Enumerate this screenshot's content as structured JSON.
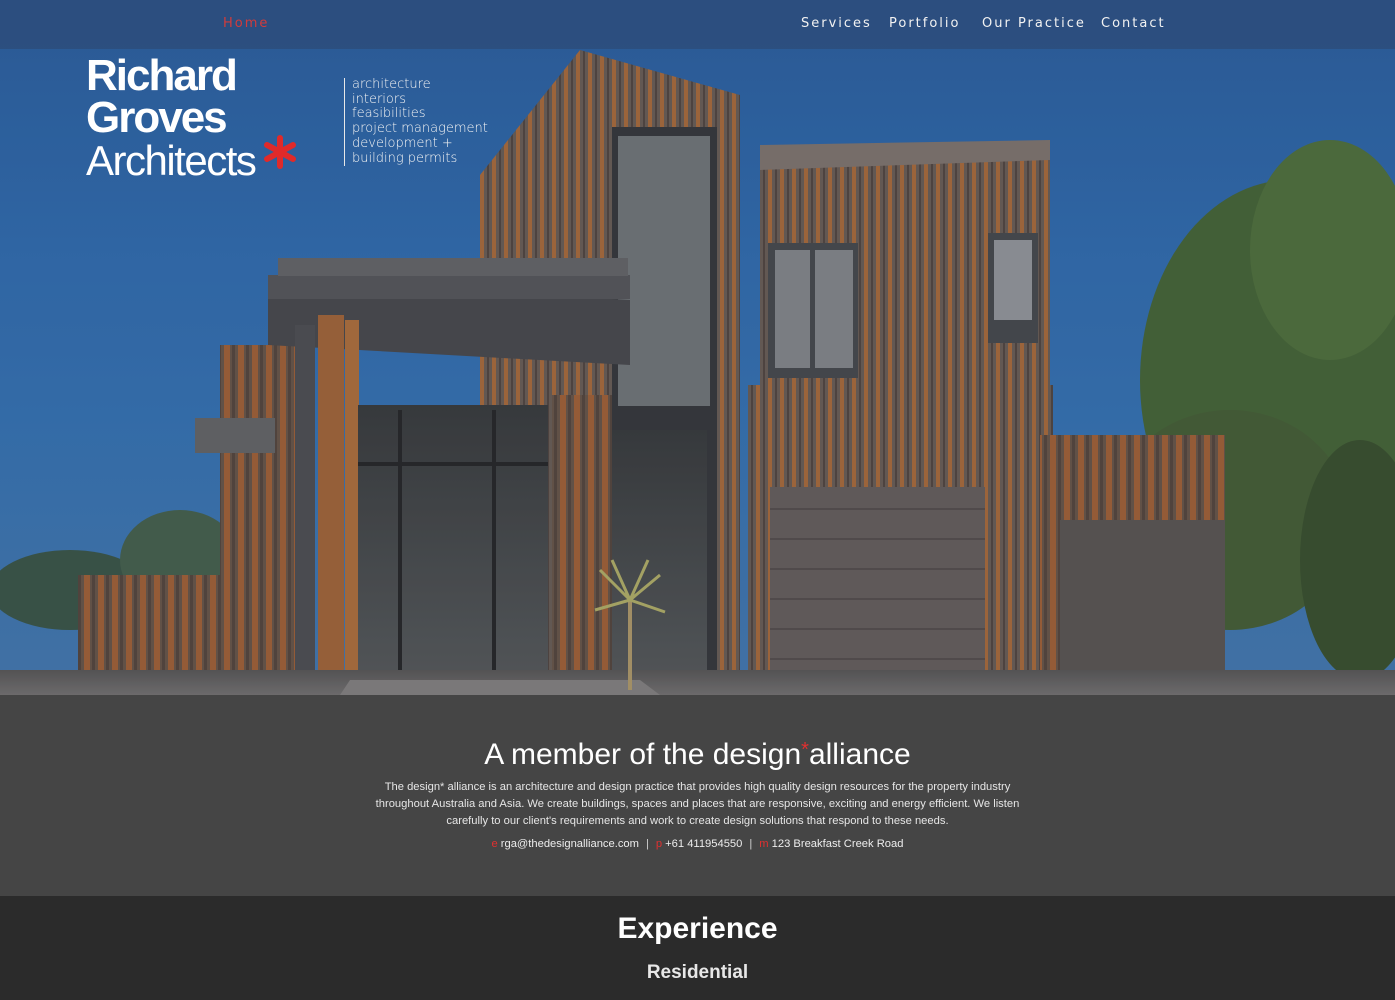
{
  "nav": {
    "home": "Home",
    "services": "Services",
    "portfolio": "Portfolio",
    "our_practice": "Our Practice",
    "contact": "Contact"
  },
  "logo": {
    "line1": "Richard",
    "line2": "Groves",
    "line3": "Architects",
    "accent_color": "#e02a2a"
  },
  "services_list": [
    "architecture",
    "interiors",
    "feasibilities",
    "project management",
    "development +",
    "building permits"
  ],
  "alliance": {
    "title_part1": "A member of the design",
    "title_star": "*",
    "title_part2": "alliance",
    "description": "The design* alliance is an architecture and design practice that provides high quality design resources for the property industry throughout Australia and Asia. We create buildings, spaces and places that are responsive, exciting and energy efficient. We listen carefully to our client's requirements and work to create design solutions that respond to these needs.",
    "contact": {
      "email_label": "e",
      "email": "rga@thedesignalliance.com",
      "phone_label": "p",
      "phone": "+61 411954550",
      "address_label": "m",
      "address": "123 Breakfast Creek Road"
    }
  },
  "experience": {
    "title": "Experience",
    "subtitle": "Residential"
  },
  "colors": {
    "accent_red": "#e03030",
    "alliance_bg": "#454545",
    "experience_bg": "#2b2b2b"
  }
}
